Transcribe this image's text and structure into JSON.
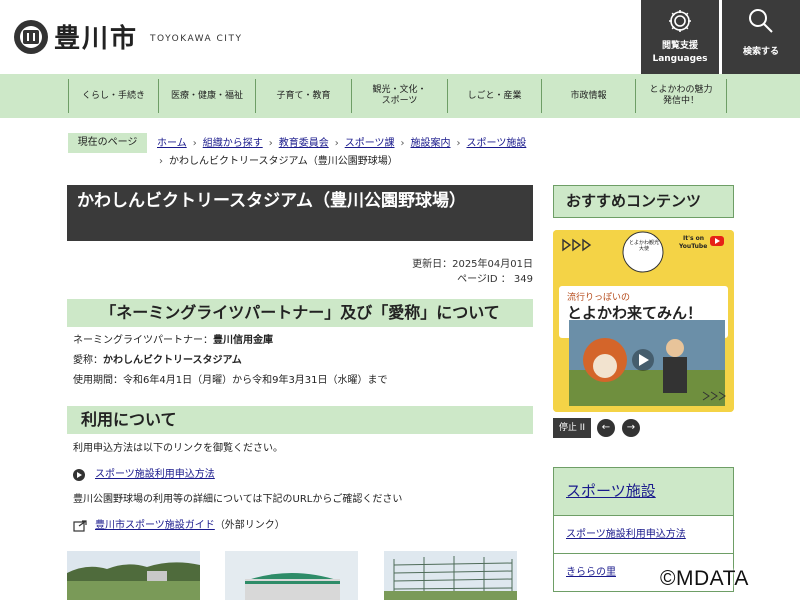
{
  "header": {
    "site_name": "豊川市",
    "site_sub": "TOYOKAWA CITY",
    "languages_label_1": "閲覧支援",
    "languages_label_2": "Languages",
    "search_label": "検索する"
  },
  "nav": {
    "items": [
      {
        "label": "くらし・手続き"
      },
      {
        "label": "医療・健康・福祉"
      },
      {
        "label": "子育て・教育"
      },
      {
        "label": "観光・文化・スポーツ"
      },
      {
        "label": "しごと・産業"
      },
      {
        "label": "市政情報"
      },
      {
        "label": "とよかわの魅力発信中！"
      }
    ]
  },
  "breadcrumb": {
    "label": "現在のページ",
    "items": [
      "ホーム",
      "組織から探す",
      "教育委員会",
      "スポーツ課",
      "施設案内",
      "スポーツ施設"
    ],
    "current": "かわしんビクトリースタジアム（豊川公園野球場）"
  },
  "page": {
    "title": "かわしんビクトリースタジアム（豊川公園野球場）",
    "updated": "更新日：2025年04月01日",
    "page_id": "ページID ： 349"
  },
  "section1": {
    "heading": "「ネーミングライツパートナー」及び「愛称」について",
    "partner_label": "ネーミングライツパートナー：",
    "partner_value": "豊川信用金庫",
    "nickname_label": "愛称：",
    "nickname_value": "かわしんビクトリースタジアム",
    "period": "使用期間：令和6年4月1日（月曜）から令和9年3月31日（水曜）まで"
  },
  "section2": {
    "heading": "利用について",
    "intro": "利用申込方法は以下のリンクを御覧ください。",
    "link1": "スポーツ施設利用申込方法",
    "detail": "豊川公園野球場の利用等の詳細については下記のURLからご確認ください",
    "link2": "豊川市スポーツ施設ガイド",
    "link2_suffix": "（外部リンク）"
  },
  "sidebar": {
    "recommend_heading": "おすすめコンテンツ",
    "banner": {
      "badge": "とよかわ観光大使",
      "youtube_small": "It's on",
      "youtube": "YouTube",
      "subtitle": "流行りっぽいの",
      "title": "とよかわ来てみん！"
    },
    "stop_label": "停止 II",
    "prev_label": "←",
    "next_label": "→",
    "sports_heading": "スポーツ施設",
    "links": [
      "スポーツ施設利用申込方法",
      "きららの里"
    ]
  },
  "watermark": "©MDATA",
  "colors": {
    "accent_green": "#cde8c8",
    "dark": "#3a3a3a",
    "link": "#1a1a8c",
    "banner_yellow": "#f4d346"
  }
}
